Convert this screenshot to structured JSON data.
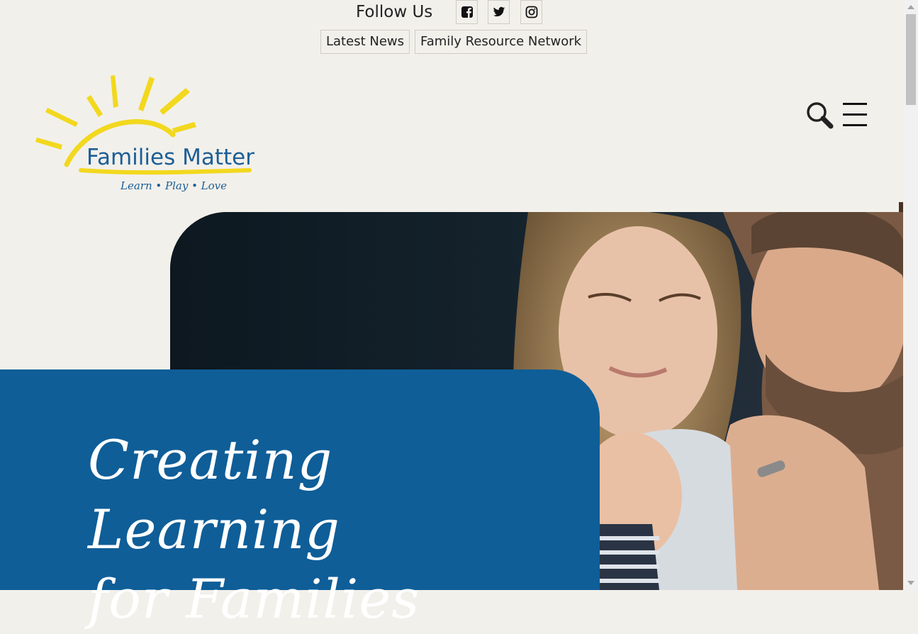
{
  "follow": {
    "label": "Follow Us",
    "icons": [
      "facebook-icon",
      "twitter-icon",
      "instagram-icon"
    ]
  },
  "nav_links": [
    "Latest News",
    "Family Resource Network"
  ],
  "logo": {
    "name": "Families Matter",
    "tagline": "Learn • Play • Love"
  },
  "header_icons": [
    "search-icon",
    "hamburger-menu-icon"
  ],
  "hero": {
    "title_line1": "Creating Learning",
    "title_line2": "for Families"
  },
  "colors": {
    "background": "#f2f0eb",
    "brand_blue": "#0f5e98",
    "logo_blue": "#1c5f96",
    "logo_yellow": "#f2d81e"
  }
}
